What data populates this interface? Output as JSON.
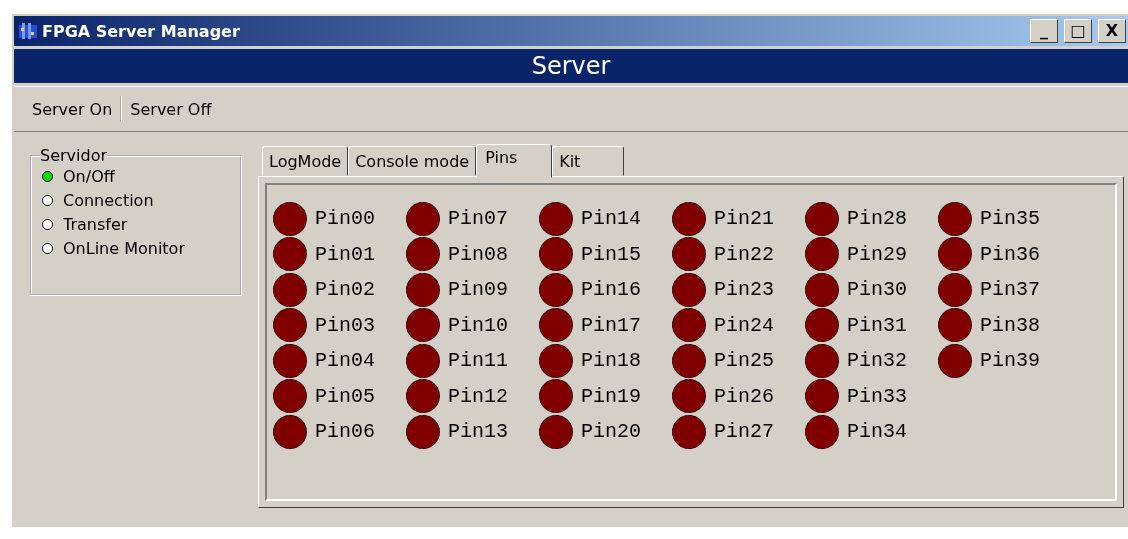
{
  "window": {
    "title": "FPGA Server Manager",
    "controls": [
      "_",
      "□",
      "X"
    ]
  },
  "header": "Server",
  "toolbar": [
    "Server On",
    "Server Off"
  ],
  "status_group": {
    "title": "Servidor",
    "items": [
      {
        "label": "On/Off",
        "on": true
      },
      {
        "label": "Connection",
        "on": false
      },
      {
        "label": "Transfer",
        "on": false
      },
      {
        "label": "OnLine Monitor",
        "on": false
      }
    ]
  },
  "tabs": [
    {
      "label": "LogMode",
      "selected": false
    },
    {
      "label": "Console mode",
      "selected": false
    },
    {
      "label": "Pins",
      "selected": true
    },
    {
      "label": "Kit",
      "selected": false
    }
  ],
  "pins": [
    {
      "label": "Pin00",
      "on": false
    },
    {
      "label": "Pin01",
      "on": false
    },
    {
      "label": "Pin02",
      "on": false
    },
    {
      "label": "Pin03",
      "on": false
    },
    {
      "label": "Pin04",
      "on": false
    },
    {
      "label": "Pin05",
      "on": false
    },
    {
      "label": "Pin06",
      "on": false
    },
    {
      "label": "Pin07",
      "on": false
    },
    {
      "label": "Pin08",
      "on": false
    },
    {
      "label": "Pin09",
      "on": false
    },
    {
      "label": "Pin10",
      "on": false
    },
    {
      "label": "Pin11",
      "on": false
    },
    {
      "label": "Pin12",
      "on": false
    },
    {
      "label": "Pin13",
      "on": false
    },
    {
      "label": "Pin14",
      "on": false
    },
    {
      "label": "Pin15",
      "on": false
    },
    {
      "label": "Pin16",
      "on": false
    },
    {
      "label": "Pin17",
      "on": false
    },
    {
      "label": "Pin18",
      "on": false
    },
    {
      "label": "Pin19",
      "on": false
    },
    {
      "label": "Pin20",
      "on": false
    },
    {
      "label": "Pin21",
      "on": false
    },
    {
      "label": "Pin22",
      "on": false
    },
    {
      "label": "Pin23",
      "on": false
    },
    {
      "label": "Pin24",
      "on": false
    },
    {
      "label": "Pin25",
      "on": false
    },
    {
      "label": "Pin26",
      "on": false
    },
    {
      "label": "Pin27",
      "on": false
    },
    {
      "label": "Pin28",
      "on": false
    },
    {
      "label": "Pin29",
      "on": false
    },
    {
      "label": "Pin30",
      "on": false
    },
    {
      "label": "Pin31",
      "on": false
    },
    {
      "label": "Pin32",
      "on": false
    },
    {
      "label": "Pin33",
      "on": false
    },
    {
      "label": "Pin34",
      "on": false
    },
    {
      "label": "Pin35",
      "on": false
    },
    {
      "label": "Pin36",
      "on": false
    },
    {
      "label": "Pin37",
      "on": false
    },
    {
      "label": "Pin38",
      "on": false
    },
    {
      "label": "Pin39",
      "on": false
    }
  ]
}
